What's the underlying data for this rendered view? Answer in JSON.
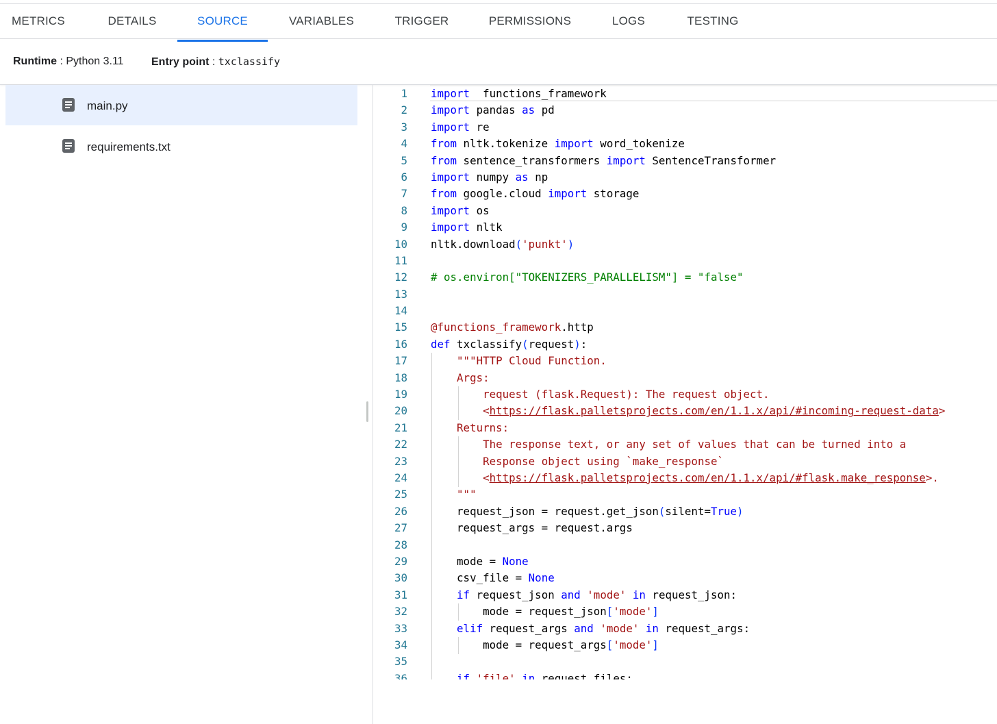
{
  "tabs": [
    {
      "label": "METRICS",
      "active": false
    },
    {
      "label": "DETAILS",
      "active": false
    },
    {
      "label": "SOURCE",
      "active": true
    },
    {
      "label": "VARIABLES",
      "active": false
    },
    {
      "label": "TRIGGER",
      "active": false
    },
    {
      "label": "PERMISSIONS",
      "active": false
    },
    {
      "label": "LOGS",
      "active": false
    },
    {
      "label": "TESTING",
      "active": false
    }
  ],
  "info": {
    "runtime_label": "Runtime",
    "runtime_sep": " : ",
    "runtime_value": "Python 3.11",
    "entry_label": "Entry point",
    "entry_sep": " : ",
    "entry_value": "txclassify"
  },
  "files": [
    {
      "name": "main.py",
      "selected": true,
      "icon": "file-text-icon"
    },
    {
      "name": "requirements.txt",
      "selected": false,
      "icon": "file-text-icon"
    }
  ],
  "colors": {
    "accent": "#1a73e8",
    "keyword": "#0000ff",
    "string": "#a31515",
    "comment": "#008000",
    "line_number": "#237893"
  },
  "code": {
    "lines": [
      [
        [
          "kw",
          "import"
        ],
        [
          "",
          "  functions_framework"
        ]
      ],
      [
        [
          "kw",
          "import"
        ],
        [
          "",
          " pandas "
        ],
        [
          "kw",
          "as"
        ],
        [
          "",
          " pd"
        ]
      ],
      [
        [
          "kw",
          "import"
        ],
        [
          "",
          " re"
        ]
      ],
      [
        [
          "kw",
          "from"
        ],
        [
          "",
          " nltk.tokenize "
        ],
        [
          "kw",
          "import"
        ],
        [
          "",
          " word_tokenize"
        ]
      ],
      [
        [
          "kw",
          "from"
        ],
        [
          "",
          " sentence_transformers "
        ],
        [
          "kw",
          "import"
        ],
        [
          "",
          " SentenceTransformer"
        ]
      ],
      [
        [
          "kw",
          "import"
        ],
        [
          "",
          " numpy "
        ],
        [
          "kw",
          "as"
        ],
        [
          "",
          " np"
        ]
      ],
      [
        [
          "kw",
          "from"
        ],
        [
          "",
          " google.cloud "
        ],
        [
          "kw",
          "import"
        ],
        [
          "",
          " storage"
        ]
      ],
      [
        [
          "kw",
          "import"
        ],
        [
          "",
          " os"
        ]
      ],
      [
        [
          "kw",
          "import"
        ],
        [
          "",
          " nltk"
        ]
      ],
      [
        [
          "",
          "nltk.download"
        ],
        [
          "par",
          "("
        ],
        [
          "str",
          "'punkt'"
        ],
        [
          "par",
          ")"
        ]
      ],
      [],
      [
        [
          "cmt",
          "# os.environ[\"TOKENIZERS_PARALLELISM\"] = \"false\""
        ]
      ],
      [],
      [],
      [
        [
          "str",
          "@functions_framework"
        ],
        [
          "",
          ".http"
        ]
      ],
      [
        [
          "kw",
          "def"
        ],
        [
          "",
          " txclassify"
        ],
        [
          "par",
          "("
        ],
        [
          "",
          "request"
        ],
        [
          "par",
          ")"
        ],
        [
          "",
          ":"
        ]
      ],
      [
        [
          "",
          "    "
        ],
        [
          "str",
          "\"\"\"HTTP Cloud Function."
        ]
      ],
      [
        [
          "",
          "    "
        ],
        [
          "str",
          "Args:"
        ]
      ],
      [
        [
          "",
          "        "
        ],
        [
          "str",
          "request (flask.Request): The request object."
        ]
      ],
      [
        [
          "",
          "        "
        ],
        [
          "str",
          "<"
        ],
        [
          "lnk",
          "https://flask.palletsprojects.com/en/1.1.x/api/#incoming-request-data"
        ],
        [
          "str",
          ">"
        ]
      ],
      [
        [
          "",
          "    "
        ],
        [
          "str",
          "Returns:"
        ]
      ],
      [
        [
          "",
          "        "
        ],
        [
          "str",
          "The response text, or any set of values that can be turned into a"
        ]
      ],
      [
        [
          "",
          "        "
        ],
        [
          "str",
          "Response object using `make_response`"
        ]
      ],
      [
        [
          "",
          "        "
        ],
        [
          "str",
          "<"
        ],
        [
          "lnk",
          "https://flask.palletsprojects.com/en/1.1.x/api/#flask.make_response"
        ],
        [
          "str",
          ">."
        ]
      ],
      [
        [
          "",
          "    "
        ],
        [
          "str",
          "\"\"\""
        ]
      ],
      [
        [
          "",
          "    request_json = request.get_json"
        ],
        [
          "par",
          "("
        ],
        [
          "",
          "silent="
        ],
        [
          "kw",
          "True"
        ],
        [
          "par",
          ")"
        ]
      ],
      [
        [
          "",
          "    request_args = request.args"
        ]
      ],
      [],
      [
        [
          "",
          "    mode = "
        ],
        [
          "kw",
          "None"
        ]
      ],
      [
        [
          "",
          "    csv_file = "
        ],
        [
          "kw",
          "None"
        ]
      ],
      [
        [
          "",
          "    "
        ],
        [
          "kw",
          "if"
        ],
        [
          "",
          " request_json "
        ],
        [
          "kw",
          "and"
        ],
        [
          "",
          " "
        ],
        [
          "str",
          "'mode'"
        ],
        [
          "",
          " "
        ],
        [
          "kw",
          "in"
        ],
        [
          "",
          " request_json:"
        ]
      ],
      [
        [
          "",
          "        mode = request_json"
        ],
        [
          "par",
          "["
        ],
        [
          "str",
          "'mode'"
        ],
        [
          "par",
          "]"
        ]
      ],
      [
        [
          "",
          "    "
        ],
        [
          "kw",
          "elif"
        ],
        [
          "",
          " request_args "
        ],
        [
          "kw",
          "and"
        ],
        [
          "",
          " "
        ],
        [
          "str",
          "'mode'"
        ],
        [
          "",
          " "
        ],
        [
          "kw",
          "in"
        ],
        [
          "",
          " request_args:"
        ]
      ],
      [
        [
          "",
          "        mode = request_args"
        ],
        [
          "par",
          "["
        ],
        [
          "str",
          "'mode'"
        ],
        [
          "par",
          "]"
        ]
      ],
      [],
      [
        [
          "",
          "    "
        ],
        [
          "kw",
          "if"
        ],
        [
          "",
          " "
        ],
        [
          "str",
          "'file'"
        ],
        [
          "",
          " "
        ],
        [
          "kw",
          "in"
        ],
        [
          "",
          " request.files:"
        ]
      ]
    ]
  }
}
